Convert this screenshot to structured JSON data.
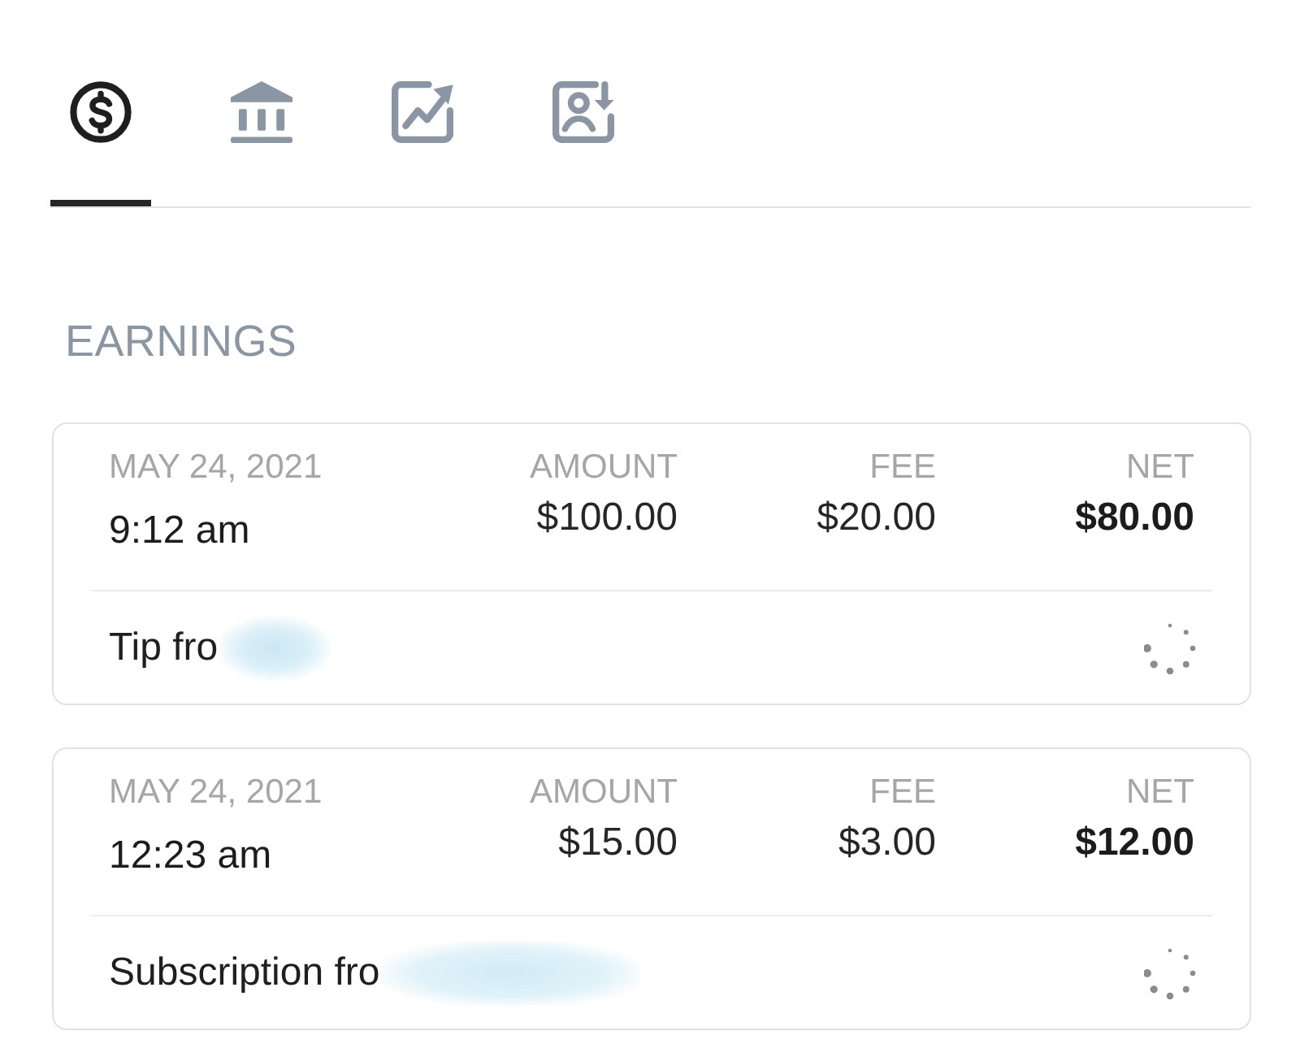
{
  "tabs": [
    {
      "kind": "dollar",
      "selected": true
    },
    {
      "kind": "bank",
      "selected": false
    },
    {
      "kind": "chart",
      "selected": false
    },
    {
      "kind": "person",
      "selected": false
    }
  ],
  "section_title": "EARNINGS",
  "transactions": [
    {
      "date": "MAY 24, 2021",
      "time": "9:12 am",
      "amount_label": "AMOUNT",
      "amount": "$100.00",
      "fee_label": "FEE",
      "fee": "$20.00",
      "net_label": "NET",
      "net": "$80.00",
      "description": "Tip fro",
      "redacted": true,
      "loading": true
    },
    {
      "date": "MAY 24, 2021",
      "time": "12:23 am",
      "amount_label": "AMOUNT",
      "amount": "$15.00",
      "fee_label": "FEE",
      "fee": "$3.00",
      "net_label": "NET",
      "net": "$12.00",
      "description": "Subscription fro",
      "redacted": true,
      "loading": true
    }
  ]
}
